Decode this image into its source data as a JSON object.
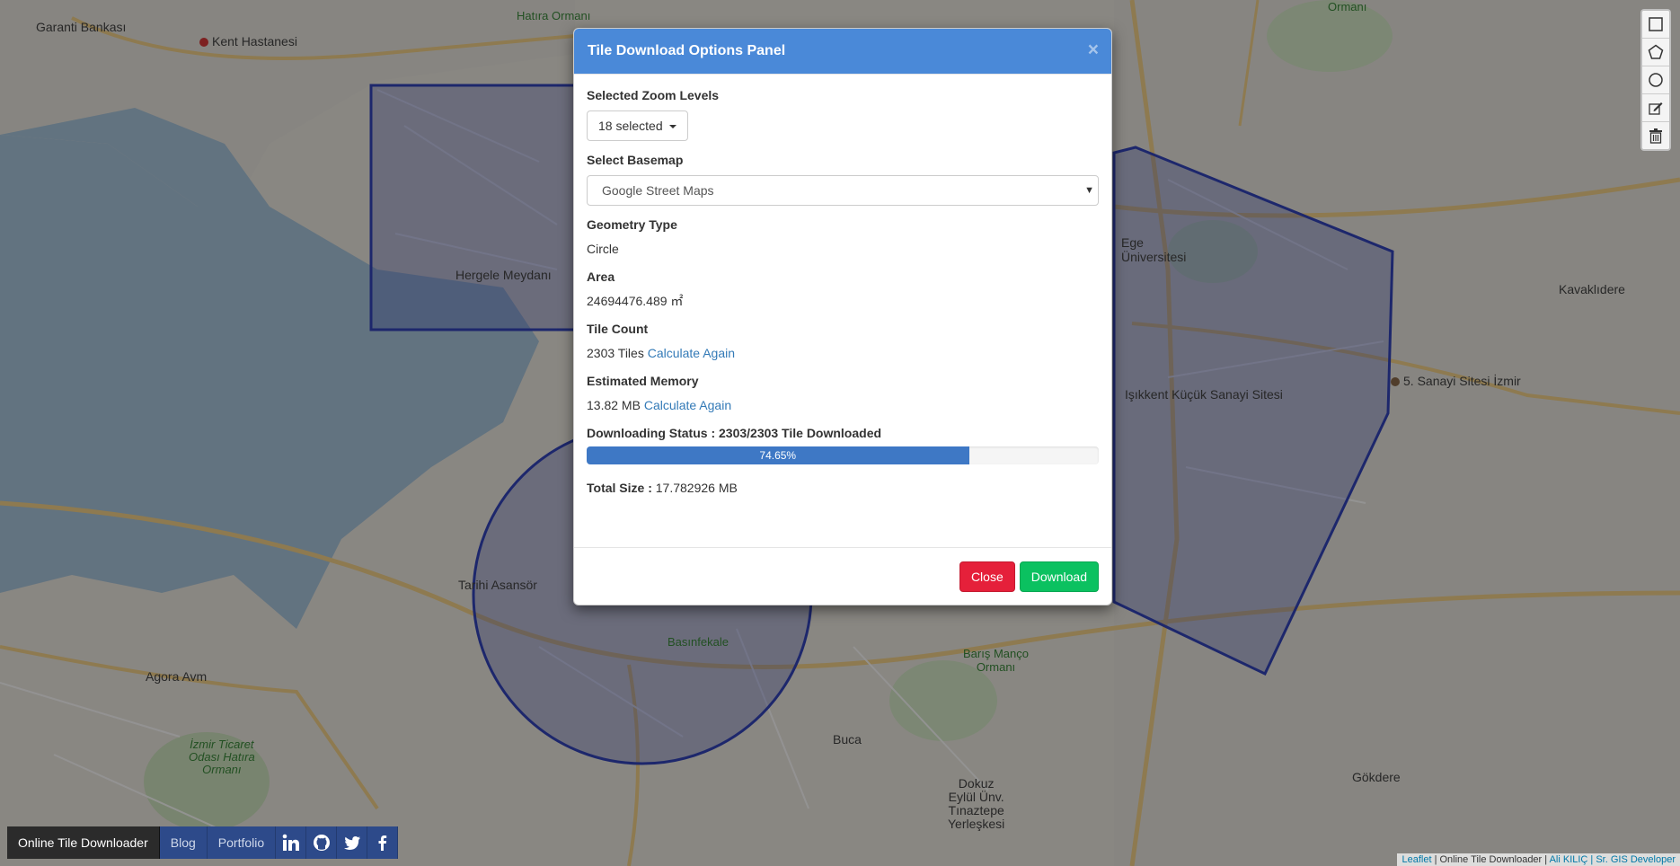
{
  "map": {
    "labels": {
      "garanti": "Garanti Bankası",
      "kent_hastanesi": "Kent Hastanesi",
      "hergele": "Hergele Meydanı",
      "tarihi_asansor": "Tarihi Asansör",
      "agora": "Agora Avm",
      "izmir_ticaret": "İzmir Ticaret\nOdası Hatıra\nOrmanı",
      "basinfekale": "Basınfekale",
      "buca": "Buca",
      "dokuz_eylul": "Dokuz\nEylül Ünv.\nTınaztepe\nYerleşkesi",
      "baris_manco": "Barış Manço\nOrmanı",
      "gokdere": "Gökdere",
      "ege_uni": "Ege\nÜniversitesi",
      "isikkent": "Işıkkent Küçük Sanayi Sitesi",
      "sanayi5": "5. Sanayi Sitesi İzmir",
      "kavaklidere": "Kavaklıdere",
      "hatira": "Hatıra Ormanı",
      "ormani": "Ormanı"
    }
  },
  "toolbar": {
    "tools": [
      {
        "name": "draw-rectangle-button",
        "icon": "rectangle-icon"
      },
      {
        "name": "draw-polygon-button",
        "icon": "pentagon-icon"
      },
      {
        "name": "draw-circle-button",
        "icon": "circle-icon"
      },
      {
        "name": "edit-layers-button",
        "icon": "pencil-icon"
      },
      {
        "name": "delete-layers-button",
        "icon": "trash-icon"
      }
    ]
  },
  "nav": {
    "brand": "Online Tile Downloader",
    "blog": "Blog",
    "portfolio": "Portfolio",
    "social": [
      "linkedin-icon",
      "github-icon",
      "twitter-icon",
      "facebook-icon"
    ]
  },
  "attribution": {
    "leaflet": "Leaflet",
    "sep1": " | Online Tile Downloader | ",
    "author": "Ali KILIÇ | Sr. GIS Developer"
  },
  "modal": {
    "title": "Tile Download Options Panel",
    "close_symbol": "×",
    "zoom_label": "Selected Zoom Levels",
    "zoom_value": "18 selected",
    "basemap_label": "Select Basemap",
    "basemap_value": "Google Street Maps",
    "geometry_label": "Geometry Type",
    "geometry_value": "Circle",
    "area_label": "Area",
    "area_value": "24694476.489 ㎡",
    "tilecount_label": "Tile Count",
    "tilecount_value": "2303 Tiles",
    "calc_again": "Calculate Again",
    "memory_label": "Estimated Memory",
    "memory_value": "13.82 MB",
    "status_label": "Downloading Status : 2303/2303 Tile Downloaded",
    "progress_text": "74.65%",
    "progress_fraction": 0.7465,
    "total_label": "Total Size :",
    "total_value": "17.782926 MB",
    "close_button": "Close",
    "download_button": "Download"
  },
  "colors": {
    "header": "#4a89d8",
    "progress": "#3e78c5",
    "danger": "#e5203a",
    "success": "#0bc160"
  }
}
